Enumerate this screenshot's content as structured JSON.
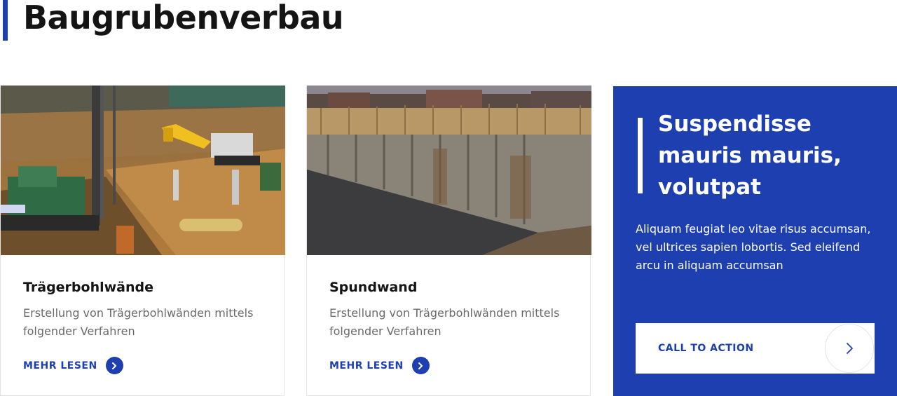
{
  "section": {
    "title": "Baugrubenverbau"
  },
  "cards": [
    {
      "title": "Trägerbohlwände",
      "text": "Erstellung von Trägerbohlwänden mittels folgender Verfahren",
      "link_label": "MEHR LESEN",
      "image": "construction-site-drilling-rig-photo"
    },
    {
      "title": "Spundwand",
      "text": "Erstellung von Trägerbohlwänden mittels folgender Verfahren",
      "link_label": "MEHR LESEN",
      "image": "sheet-pile-wall-photo"
    }
  ],
  "cta": {
    "title": "Suspendisse mauris mauris, volutpat",
    "text": "Aliquam feugiat leo vitae risus accumsan, vel ultrices sapien lobortis. Sed eleifend arcu in aliquam accumsan",
    "button_label": "CALL TO ACTION",
    "button_icon": "chevron-right-icon"
  },
  "colors": {
    "accent": "#1d3fb0",
    "text_dark": "#141414",
    "text_muted": "#6a6a6a"
  }
}
